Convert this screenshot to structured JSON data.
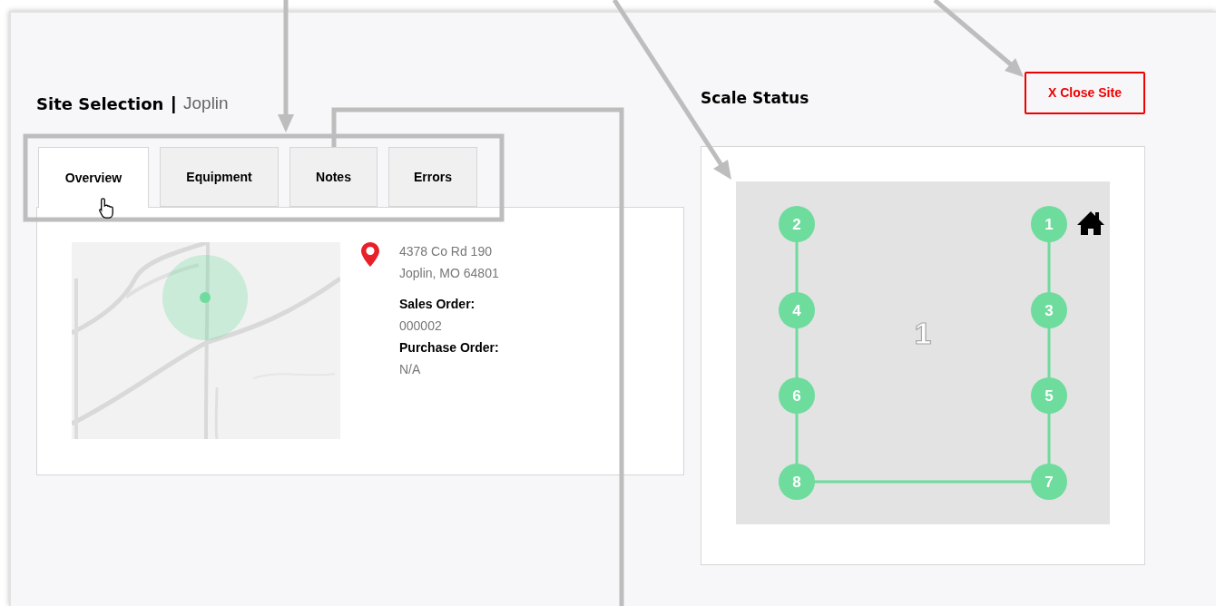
{
  "header": {
    "title": "Site Selection",
    "separator": "|",
    "site": "Joplin"
  },
  "tabs": [
    {
      "label": "Overview",
      "selected": true
    },
    {
      "label": "Equipment",
      "selected": false
    },
    {
      "label": "Notes",
      "selected": false
    },
    {
      "label": "Errors",
      "selected": false
    }
  ],
  "location": {
    "address_line_1": "4378 Co Rd 190",
    "address_line_2": "Joplin, MO 64801"
  },
  "details": [
    {
      "label": "Sales Order:",
      "value": "000002"
    },
    {
      "label": "Purchase Order:",
      "value": "N/A"
    }
  ],
  "scale_status": {
    "title": "Scale Status",
    "close_button": "X Close Site",
    "scale_label": "1",
    "nodes": [
      {
        "label": "2",
        "home": false
      },
      {
        "label": "1",
        "home": true
      },
      {
        "label": "4",
        "home": false
      },
      {
        "label": "3",
        "home": false
      },
      {
        "label": "6",
        "home": false
      },
      {
        "label": "5",
        "home": false
      },
      {
        "label": "8",
        "home": false
      },
      {
        "label": "7",
        "home": false
      }
    ]
  }
}
